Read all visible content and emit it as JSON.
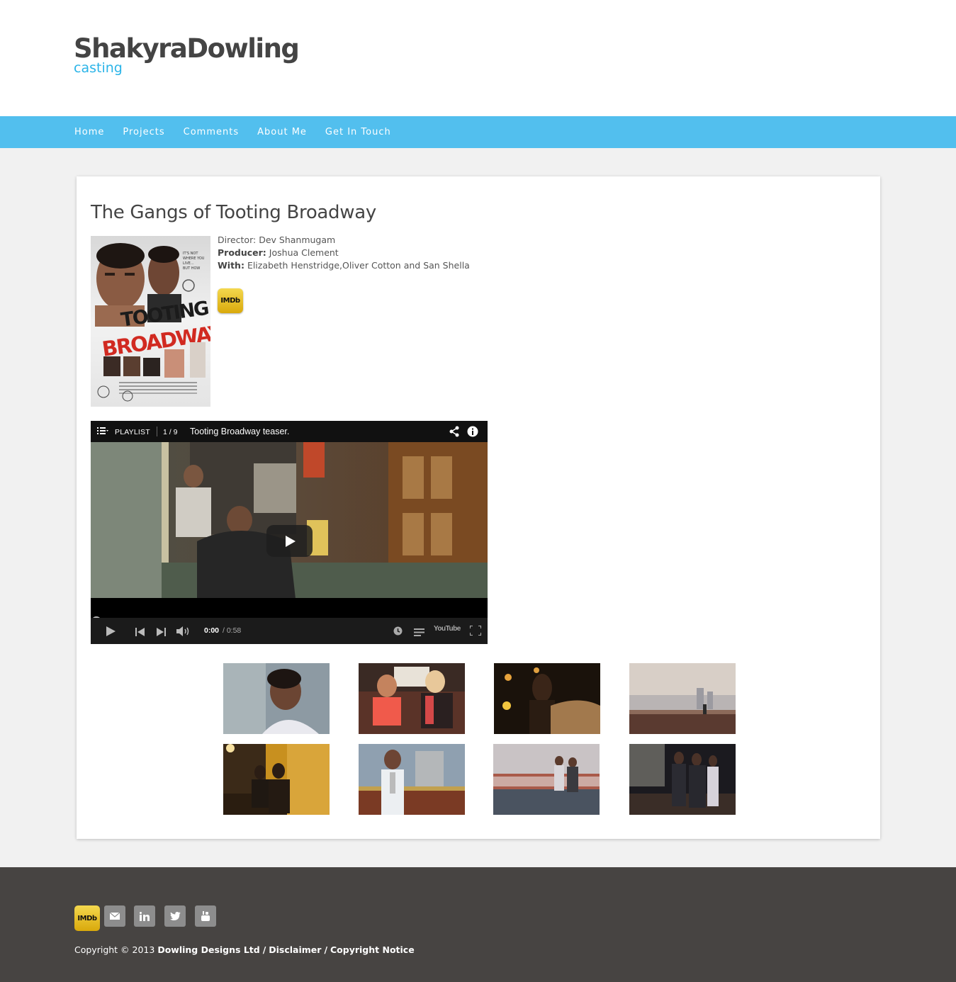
{
  "brand": {
    "name": "ShakyraDowling",
    "tagline": "casting"
  },
  "nav": {
    "items": [
      {
        "label": "Home"
      },
      {
        "label": "Projects"
      },
      {
        "label": "Comments"
      },
      {
        "label": "About Me"
      },
      {
        "label": "Get In Touch"
      }
    ]
  },
  "project": {
    "title": "The Gangs of Tooting Broadway",
    "poster": {
      "line1": "TOOTING",
      "line2": "BROADWAY",
      "tagline": "IT'S NOT WHERE YOU LIVE... BUT HOW"
    },
    "credits": {
      "director_label": "Director:",
      "director": "Dev Shanmugam",
      "producer_label": "Producer:",
      "producer": "Joshua Clement",
      "with_label": "With:",
      "with": "Elizabeth Henstridge,Oliver Cotton and San Shella"
    },
    "imdb_label": "IMDb"
  },
  "video": {
    "playlist_label": "PLAYLIST",
    "playlist_position": "1 / 9",
    "title": "Tooting Broadway teaser.",
    "current_time": "0:00",
    "duration": "/ 0:58",
    "youtube_label": "YouTube",
    "progress": 0
  },
  "gallery": {
    "rows": 2,
    "count": 8
  },
  "footer": {
    "imdb_label": "IMDb",
    "copyright_prefix": "Copyright © 2013",
    "company": "Dowling Designs Ltd",
    "sep1": "/",
    "disclaimer": "Disclaimer",
    "sep2": "/",
    "copyright_notice": "Copyright Notice"
  },
  "colors": {
    "accent": "#52bfee",
    "tagline": "#2bb4e8",
    "footer_bg": "#474442",
    "page_bg": "#f1f1f1"
  }
}
